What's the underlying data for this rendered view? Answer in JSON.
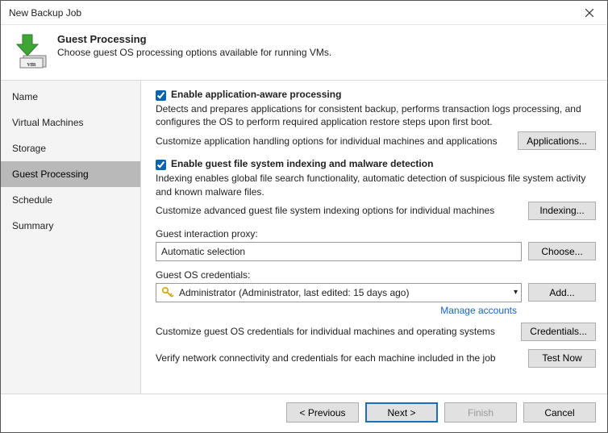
{
  "window": {
    "title": "New Backup Job"
  },
  "header": {
    "title": "Guest Processing",
    "subtitle": "Choose guest OS processing options available for running VMs."
  },
  "sidebar": {
    "items": [
      {
        "label": "Name"
      },
      {
        "label": "Virtual Machines"
      },
      {
        "label": "Storage"
      },
      {
        "label": "Guest Processing"
      },
      {
        "label": "Schedule"
      },
      {
        "label": "Summary"
      }
    ],
    "selected_index": 3
  },
  "main": {
    "app_aware": {
      "label": "Enable application-aware processing",
      "checked": true,
      "desc": "Detects and prepares applications for consistent backup, performs transaction logs processing, and configures the OS to perform required application restore steps upon first boot.",
      "customize_text": "Customize application handling options for individual machines and applications",
      "button": "Applications..."
    },
    "indexing": {
      "label": "Enable guest file system indexing and malware detection",
      "checked": true,
      "desc": "Indexing enables global file search functionality, automatic detection of suspicious file system activity and known malware files.",
      "customize_text": "Customize advanced guest file system indexing options for individual machines",
      "button": "Indexing..."
    },
    "proxy": {
      "label": "Guest interaction proxy:",
      "value": "Automatic selection",
      "button": "Choose..."
    },
    "credentials": {
      "label": "Guest OS credentials:",
      "value": "Administrator (Administrator, last edited: 15 days ago)",
      "button": "Add...",
      "manage_link": "Manage accounts",
      "customize_text": "Customize guest OS credentials for individual machines and operating systems",
      "credentials_button": "Credentials...",
      "verify_text": "Verify network connectivity and credentials for each machine included in the job",
      "test_button": "Test Now"
    }
  },
  "footer": {
    "previous": "< Previous",
    "next": "Next >",
    "finish": "Finish",
    "cancel": "Cancel"
  }
}
